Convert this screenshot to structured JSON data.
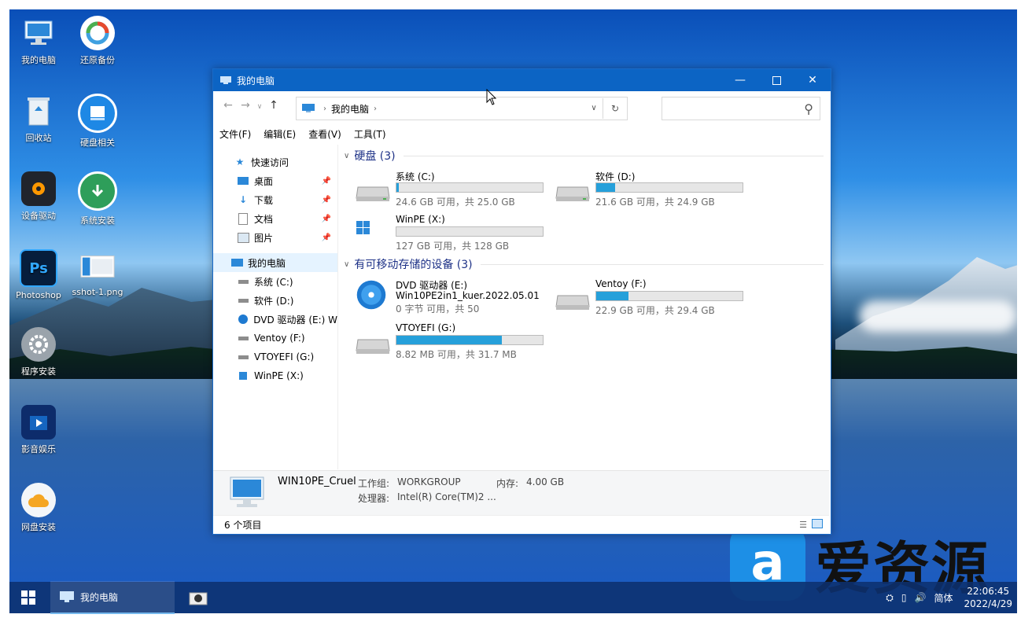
{
  "desktop": {
    "icons": [
      {
        "label": "我的电脑",
        "icon": "computer-icon"
      },
      {
        "label": "还原备份",
        "icon": "restore-icon"
      },
      {
        "label": "回收站",
        "icon": "recycle-bin-icon"
      },
      {
        "label": "硬盘相关",
        "icon": "disk-icon"
      },
      {
        "label": "设备驱动",
        "icon": "driver-icon"
      },
      {
        "label": "系统安装",
        "icon": "install-icon"
      },
      {
        "label": "Photoshop",
        "icon": "photoshop-icon"
      },
      {
        "label": "sshot-1.png",
        "icon": "image-file-icon"
      },
      {
        "label": "程序安装",
        "icon": "program-install-icon"
      },
      {
        "label": "影音娱乐",
        "icon": "media-icon"
      },
      {
        "label": "网盘安装",
        "icon": "cloud-drive-icon"
      }
    ]
  },
  "window": {
    "title": "我的电脑",
    "breadcrumb": "我的电脑",
    "menu": [
      "文件(F)",
      "编辑(E)",
      "查看(V)",
      "工具(T)"
    ],
    "nav": {
      "quick_access": "快速访问",
      "quick_items": [
        "桌面",
        "下载",
        "文档",
        "图片"
      ],
      "this_pc": "我的电脑",
      "drives": [
        "系统 (C:)",
        "软件 (D:)",
        "DVD 驱动器 (E:) W",
        "Ventoy (F:)",
        "VTOYEFI (G:)",
        "WinPE (X:)"
      ]
    },
    "groups": {
      "hard_disks": "硬盘 (3)",
      "removable": "有可移动存储的设备 (3)"
    },
    "drives": [
      {
        "name": "系统 (C:)",
        "free": "24.6 GB 可用，共 25.0 GB",
        "used_fraction": 0.016
      },
      {
        "name": "软件 (D:)",
        "free": "21.6 GB 可用，共 24.9 GB",
        "used_fraction": 0.13
      },
      {
        "name": "WinPE (X:)",
        "free": "127 GB 可用，共 128 GB",
        "used_fraction": 0.0
      },
      {
        "name": "DVD 驱动器 (E:)",
        "sub": "Win10PE2in1_kuer.2022.05.01",
        "free": "0 字节 可用，共 50"
      },
      {
        "name": "Ventoy (F:)",
        "free": "22.9 GB 可用，共 29.4 GB",
        "used_fraction": 0.22
      },
      {
        "name": "VTOYEFI (G:)",
        "free": "8.82 MB 可用，共 31.7 MB",
        "used_fraction": 0.72
      }
    ],
    "details": {
      "computer_name": "WIN10PE_Cruel",
      "workgroup_label": "工作组:",
      "workgroup": "WORKGROUP",
      "memory_label": "内存:",
      "memory": "4.00 GB",
      "cpu_label": "处理器:",
      "cpu": "Intel(R) Core(TM)2 ..."
    },
    "status": "6 个项目"
  },
  "taskbar": {
    "app_label": "我的电脑",
    "ime": "简体",
    "time": "22:06:45",
    "date": "2022/4/29"
  },
  "watermark": {
    "logo_char": "a",
    "text": "爱资源"
  },
  "colors": {
    "titlebar": "#0c64c4",
    "drive_bar": "#26a0da",
    "group_header": "#1e3287"
  }
}
